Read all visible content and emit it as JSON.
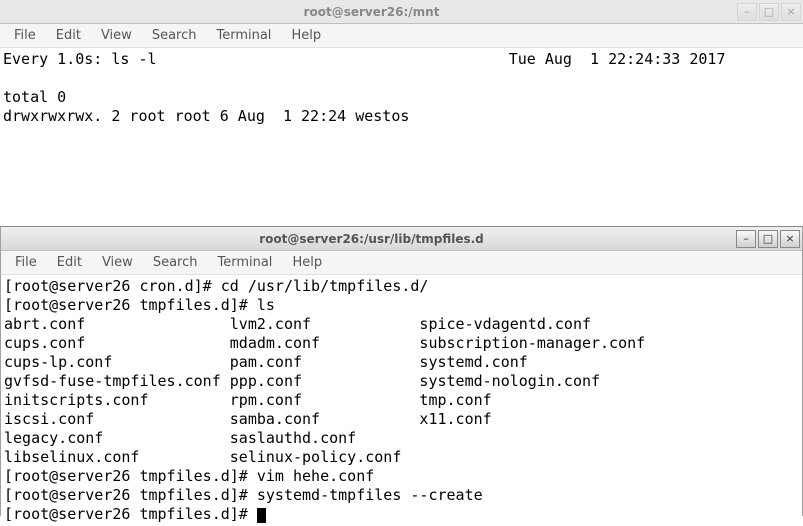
{
  "menus": {
    "file": "File",
    "edit": "Edit",
    "view": "View",
    "search": "Search",
    "terminal": "Terminal",
    "help": "Help"
  },
  "win1": {
    "title": "root@server26:/mnt",
    "watch_header_left": "Every 1.0s: ls -l",
    "watch_header_right": "Tue Aug  1 22:24:33 2017",
    "total_line": "total 0",
    "listing_line": "drwxrwxrwx. 2 root root 6 Aug  1 22:24 westos"
  },
  "win2": {
    "title": "root@server26:/usr/lib/tmpfiles.d",
    "lines": {
      "l0": "[root@server26 cron.d]# cd /usr/lib/tmpfiles.d/",
      "l1": "[root@server26 tmpfiles.d]# ls",
      "l2": "abrt.conf                lvm2.conf            spice-vdagentd.conf",
      "l3": "cups.conf                mdadm.conf           subscription-manager.conf",
      "l4": "cups-lp.conf             pam.conf             systemd.conf",
      "l5": "gvfsd-fuse-tmpfiles.conf ppp.conf             systemd-nologin.conf",
      "l6": "initscripts.conf         rpm.conf             tmp.conf",
      "l7": "iscsi.conf               samba.conf           x11.conf",
      "l8": "legacy.conf              saslauthd.conf",
      "l9": "libselinux.conf          selinux-policy.conf",
      "l10": "[root@server26 tmpfiles.d]# vim hehe.conf",
      "l11": "[root@server26 tmpfiles.d]# systemd-tmpfiles --create",
      "l12_prefix": "[root@server26 tmpfiles.d]# "
    }
  },
  "icons": {
    "minimize": "–",
    "maximize": "□",
    "close": "×"
  }
}
